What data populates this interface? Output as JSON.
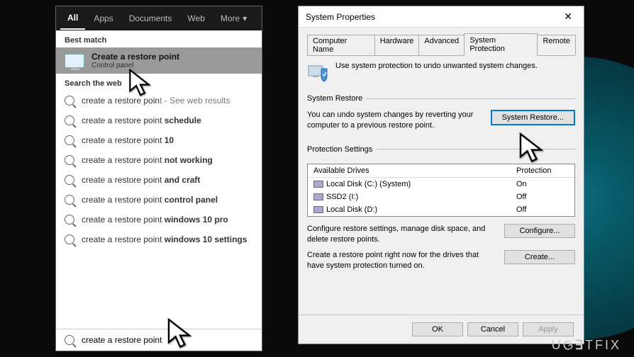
{
  "search": {
    "tabs": {
      "all": "All",
      "apps": "Apps",
      "documents": "Documents",
      "web": "Web",
      "more": "More"
    },
    "best_match_label": "Best match",
    "best_match": {
      "title": "Create a restore point",
      "subtitle": "Control panel"
    },
    "search_web_label": "Search the web",
    "web_results": [
      "create a restore point - See web results",
      "create a restore point schedule",
      "create a restore point 10",
      "create a restore point not working",
      "create a restore point and craft",
      "create a restore point control panel",
      "create a restore point windows 10 pro",
      "create a restore point windows 10 settings"
    ],
    "input_value": "create a restore point"
  },
  "dialog": {
    "title": "System Properties",
    "tabs": {
      "computer_name": "Computer Name",
      "hardware": "Hardware",
      "advanced": "Advanced",
      "system_protection": "System Protection",
      "remote": "Remote"
    },
    "intro": "Use system protection to undo unwanted system changes.",
    "restore": {
      "legend": "System Restore",
      "text": "You can undo system changes by reverting your computer to a previous restore point.",
      "button": "System Restore..."
    },
    "protection": {
      "legend": "Protection Settings",
      "col_drives": "Available Drives",
      "col_protection": "Protection",
      "drives": [
        {
          "name": "Local Disk (C:) (System)",
          "protection": "On"
        },
        {
          "name": "SSD2 (I:)",
          "protection": "Off"
        },
        {
          "name": "Local Disk (D:)",
          "protection": "Off"
        }
      ],
      "configure_text": "Configure restore settings, manage disk space, and delete restore points.",
      "configure_button": "Configure...",
      "create_text": "Create a restore point right now for the drives that have system protection turned on.",
      "create_button": "Create..."
    },
    "buttons": {
      "ok": "OK",
      "cancel": "Cancel",
      "apply": "Apply"
    }
  },
  "watermark": "UGETFIX"
}
